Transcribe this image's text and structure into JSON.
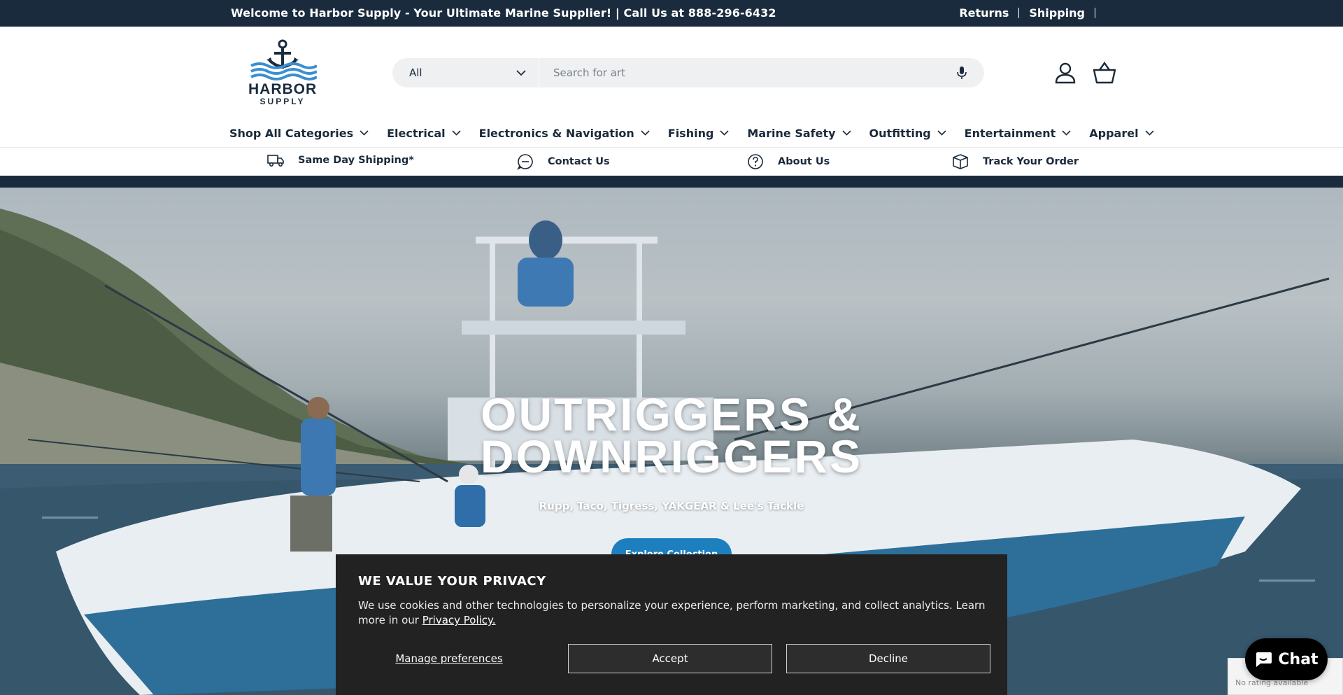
{
  "announcement": {
    "message": "Welcome to Harbor Supply - Your Ultimate Marine Supplier! | Call Us at 888-296-6432",
    "links": [
      "Returns",
      "Shipping"
    ]
  },
  "logo": {
    "line1": "HARBOR",
    "line2": "SUPPLY"
  },
  "search": {
    "category": "All",
    "placeholder": "Search for art"
  },
  "nav": {
    "items": [
      {
        "label": "Shop All Categories"
      },
      {
        "label": "Electrical"
      },
      {
        "label": "Electronics & Navigation"
      },
      {
        "label": "Fishing"
      },
      {
        "label": "Marine Safety"
      },
      {
        "label": "Outfitting"
      },
      {
        "label": "Entertainment"
      },
      {
        "label": "Apparel"
      }
    ]
  },
  "utility": {
    "items": [
      {
        "label": "Same Day Shipping*",
        "icon": "truck-icon"
      },
      {
        "label": "Contact Us",
        "icon": "chat-bubble-icon"
      },
      {
        "label": "About Us",
        "icon": "question-circle-icon"
      },
      {
        "label": "Track Your Order",
        "icon": "package-icon"
      }
    ]
  },
  "hero": {
    "title_line1": "OUTRIGGERS &",
    "title_line2": "DOWNRIGGERS",
    "subtitle": "Rupp, Taco, Tigress, YAKGEAR & Lee's Tackle",
    "button": "Explore Collection"
  },
  "cookie": {
    "title": "WE VALUE YOUR PRIVACY",
    "body": "We use cookies and other technologies to personalize your experience, perform marketing, and collect analytics. Learn more in our",
    "link": "Privacy Policy.",
    "manage": "Manage preferences",
    "accept": "Accept",
    "decline": "Decline"
  },
  "chat": {
    "label": "Chat"
  },
  "rating": {
    "text": "No rating available"
  },
  "colors": {
    "navy": "#1a2b3d",
    "accent_blue": "#1e7fbf",
    "cookie_bg": "#222222"
  }
}
